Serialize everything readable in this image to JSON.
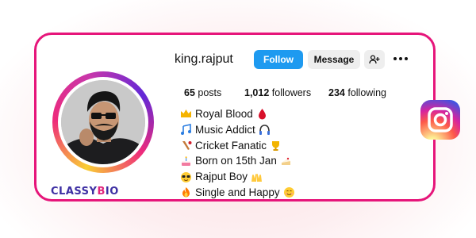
{
  "profile": {
    "username": "king.rajput",
    "follow_label": "Follow",
    "message_label": "Message",
    "stats": {
      "posts_count": "65",
      "posts_label": "posts",
      "followers_count": "1,012",
      "followers_label": "followers",
      "following_count": "234",
      "following_label": "following"
    },
    "bio": [
      {
        "icon": "crown-icon",
        "text": "Royal Blood",
        "trail_icon": "blood-drop-icon"
      },
      {
        "icon": "music-notes-icon",
        "text": "Music Addict",
        "trail_icon": "headphones-icon"
      },
      {
        "icon": "cricket-bat-icon",
        "text": "Cricket Fanatic",
        "trail_icon": "trophy-icon"
      },
      {
        "icon": "birthday-cake-icon",
        "text": "Born on 15th Jan",
        "trail_icon": "cake-slice-icon"
      },
      {
        "icon": "sunglasses-face-icon",
        "text": "Rajput Boy",
        "trail_icon": "raised-hands-icon"
      },
      {
        "icon": "fire-icon",
        "text": "Single and Happy",
        "trail_icon": "smiling-face-icon"
      }
    ]
  },
  "branding": {
    "logo_text_1": "CLASSY",
    "logo_text_2": "B",
    "logo_text_3": "IO"
  },
  "icons": {
    "add_user": "add-user-icon",
    "more": "more-options-icon",
    "instagram": "instagram-icon"
  },
  "colors": {
    "card_border": "#e6157a",
    "follow_button": "#1e9af0",
    "message_button": "#eeeeee",
    "brand_text": "#3d2fa3"
  }
}
